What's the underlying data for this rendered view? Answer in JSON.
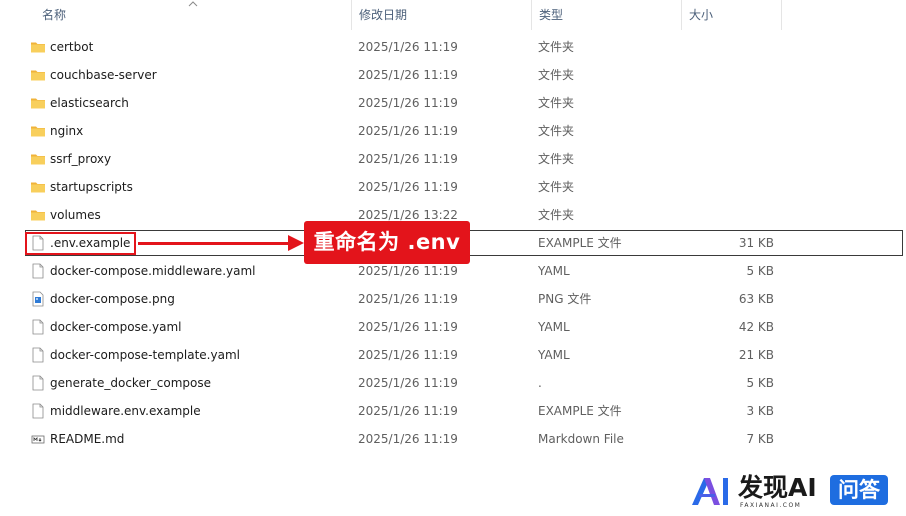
{
  "columns": {
    "name": "名称",
    "date": "修改日期",
    "type": "类型",
    "size": "大小"
  },
  "files": [
    {
      "name": "certbot",
      "date": "2025/1/26 11:19",
      "type": "文件夹",
      "size": "",
      "icon": "folder"
    },
    {
      "name": "couchbase-server",
      "date": "2025/1/26 11:19",
      "type": "文件夹",
      "size": "",
      "icon": "folder"
    },
    {
      "name": "elasticsearch",
      "date": "2025/1/26 11:19",
      "type": "文件夹",
      "size": "",
      "icon": "folder"
    },
    {
      "name": "nginx",
      "date": "2025/1/26 11:19",
      "type": "文件夹",
      "size": "",
      "icon": "folder"
    },
    {
      "name": "ssrf_proxy",
      "date": "2025/1/26 11:19",
      "type": "文件夹",
      "size": "",
      "icon": "folder"
    },
    {
      "name": "startupscripts",
      "date": "2025/1/26 11:19",
      "type": "文件夹",
      "size": "",
      "icon": "folder"
    },
    {
      "name": "volumes",
      "date": "2025/1/26 13:22",
      "type": "文件夹",
      "size": "",
      "icon": "folder"
    },
    {
      "name": ".env.example",
      "date": "",
      "type": "EXAMPLE 文件",
      "size": "31 KB",
      "icon": "file"
    },
    {
      "name": "docker-compose.middleware.yaml",
      "date": "2025/1/26 11:19",
      "type": "YAML",
      "size": "5 KB",
      "icon": "file"
    },
    {
      "name": "docker-compose.png",
      "date": "2025/1/26 11:19",
      "type": "PNG 文件",
      "size": "63 KB",
      "icon": "image"
    },
    {
      "name": "docker-compose.yaml",
      "date": "2025/1/26 11:19",
      "type": "YAML",
      "size": "42 KB",
      "icon": "file"
    },
    {
      "name": "docker-compose-template.yaml",
      "date": "2025/1/26 11:19",
      "type": "YAML",
      "size": "21 KB",
      "icon": "file"
    },
    {
      "name": "generate_docker_compose",
      "date": "2025/1/26 11:19",
      "type": ".",
      "size": "5 KB",
      "icon": "file"
    },
    {
      "name": "middleware.env.example",
      "date": "2025/1/26 11:19",
      "type": "EXAMPLE 文件",
      "size": "3 KB",
      "icon": "file"
    },
    {
      "name": "README.md",
      "date": "2025/1/26 11:19",
      "type": "Markdown File",
      "size": "7 KB",
      "icon": "markdown"
    }
  ],
  "annotation": {
    "callout": "重命名为 .env"
  },
  "watermark": {
    "brand": "发现AI",
    "sub": "FAXIANAI.COM",
    "badge": "问答"
  },
  "colors": {
    "accent_red": "#e3141b",
    "folder": "#f5c24c",
    "badge": "#1e6de0"
  }
}
